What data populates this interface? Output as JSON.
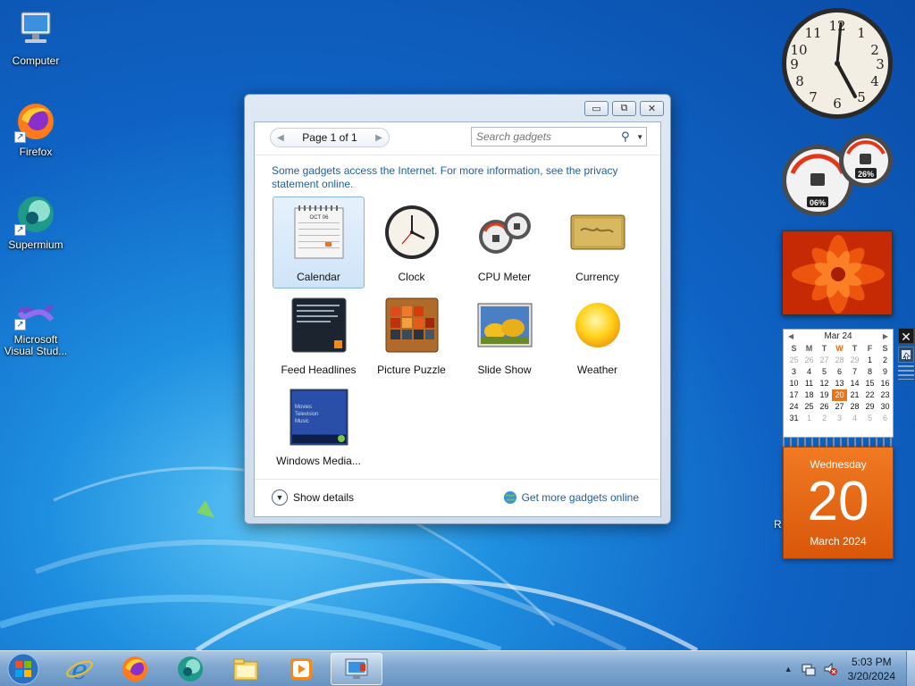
{
  "desktop": {
    "icons": [
      {
        "label": "Computer",
        "icon": "computer-icon"
      },
      {
        "label": "Firefox",
        "icon": "firefox-icon"
      },
      {
        "label": "Supermium",
        "icon": "supermium-icon"
      },
      {
        "label": "Microsoft Visual Stud...",
        "icon": "visual-studio-icon"
      }
    ]
  },
  "gallery": {
    "pager_text": "Page 1 of 1",
    "search_placeholder": "Search gadgets",
    "notice_text": "Some gadgets access the Internet.  For more information, see the privacy statement online.",
    "gadgets": [
      {
        "label": "Calendar",
        "icon": "calendar-icon",
        "selected": true
      },
      {
        "label": "Clock",
        "icon": "clock-icon"
      },
      {
        "label": "CPU Meter",
        "icon": "cpu-meter-icon"
      },
      {
        "label": "Currency",
        "icon": "currency-icon"
      },
      {
        "label": "Feed Headlines",
        "icon": "feed-headlines-icon"
      },
      {
        "label": "Picture Puzzle",
        "icon": "picture-puzzle-icon"
      },
      {
        "label": "Slide Show",
        "icon": "slide-show-icon"
      },
      {
        "label": "Weather",
        "icon": "weather-icon"
      },
      {
        "label": "Windows Media...",
        "icon": "windows-media-icon"
      }
    ],
    "thumb_calendar_month": "OCT 06",
    "thumb_media_lines": [
      "Movies",
      "Television",
      "Music"
    ],
    "show_details": "Show details",
    "get_more": "Get more gadgets online"
  },
  "sidebar": {
    "cpu_left": "06%",
    "cpu_right": "26%",
    "calendar": {
      "month_label": "Mar 24",
      "dow": [
        "S",
        "M",
        "T",
        "W",
        "T",
        "F",
        "S"
      ],
      "today_dow_index": 3,
      "weeks": [
        [
          "25",
          "26",
          "27",
          "28",
          "29",
          "1",
          "2"
        ],
        [
          "3",
          "4",
          "5",
          "6",
          "7",
          "8",
          "9"
        ],
        [
          "10",
          "11",
          "12",
          "13",
          "14",
          "15",
          "16"
        ],
        [
          "17",
          "18",
          "19",
          "20",
          "21",
          "22",
          "23"
        ],
        [
          "24",
          "25",
          "26",
          "27",
          "28",
          "29",
          "30"
        ],
        [
          "31",
          "1",
          "2",
          "3",
          "4",
          "5",
          "6"
        ]
      ],
      "weekday": "Wednesday",
      "day": "20",
      "month_year": "March 2024"
    },
    "partial_text": "R",
    "close_glyph": "✕"
  },
  "taskbar": {
    "time": "5:03 PM",
    "date": "3/20/2024",
    "buttons": [
      {
        "name": "ie-icon"
      },
      {
        "name": "firefox-icon"
      },
      {
        "name": "supermium-icon"
      },
      {
        "name": "explorer-icon"
      },
      {
        "name": "media-player-icon"
      },
      {
        "name": "gadgets-icon",
        "active": true
      }
    ]
  },
  "colors": {
    "accent_orange": "#e8761f",
    "link_blue": "#1f5d9e"
  }
}
